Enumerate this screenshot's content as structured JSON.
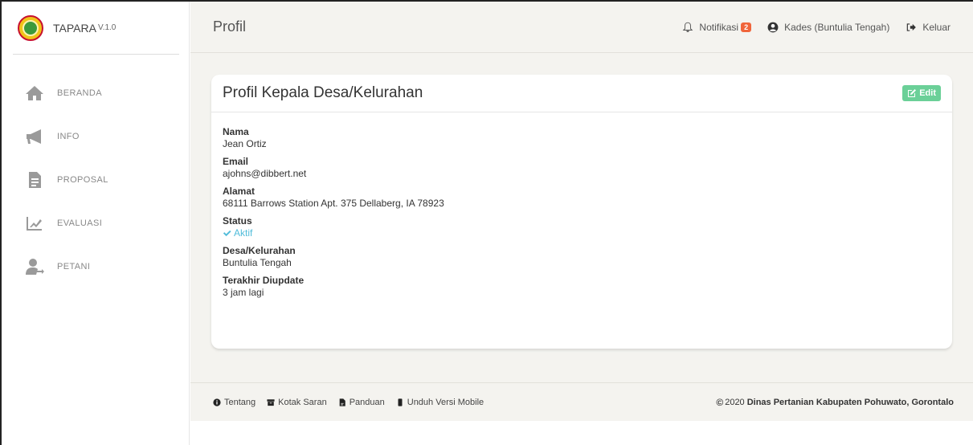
{
  "brand": {
    "name": "TAPARA",
    "version": "V.1.0"
  },
  "sidebar": {
    "items": [
      {
        "label": "BERANDA",
        "icon": "home-icon"
      },
      {
        "label": "INFO",
        "icon": "megaphone-icon"
      },
      {
        "label": "PROPOSAL",
        "icon": "document-icon"
      },
      {
        "label": "EVALUASI",
        "icon": "chart-edit-icon"
      },
      {
        "label": "PETANI",
        "icon": "user-icon"
      }
    ]
  },
  "topbar": {
    "title": "Profil",
    "notifications_label": "Notifikasi",
    "notifications_count": "2",
    "user_label": "Kades (Buntulia Tengah)",
    "logout_label": "Keluar"
  },
  "card": {
    "title": "Profil Kepala Desa/Kelurahan",
    "edit_label": "Edit",
    "fields": {
      "nama_label": "Nama",
      "nama_value": "Jean Ortiz",
      "email_label": "Email",
      "email_value": "ajohns@dibbert.net",
      "alamat_label": "Alamat",
      "alamat_value": "68111 Barrows Station Apt. 375 Dellaberg, IA 78923",
      "status_label": "Status",
      "status_value": "Aktif",
      "desa_label": "Desa/Kelurahan",
      "desa_value": "Buntulia Tengah",
      "update_label": "Terakhir Diupdate",
      "update_value": "3 jam lagi"
    }
  },
  "footer": {
    "links": [
      "Tentang",
      "Kotak Saran",
      "Panduan",
      "Unduh Versi Mobile"
    ],
    "copyright_year": "2020",
    "copyright_org": "Dinas Pertanian Kabupaten Pohuwato, Gorontalo"
  },
  "colors": {
    "accent_green": "#6bd098",
    "status_blue": "#51bcda",
    "badge_orange": "#f0653b",
    "main_bg": "#f4f3ef"
  }
}
